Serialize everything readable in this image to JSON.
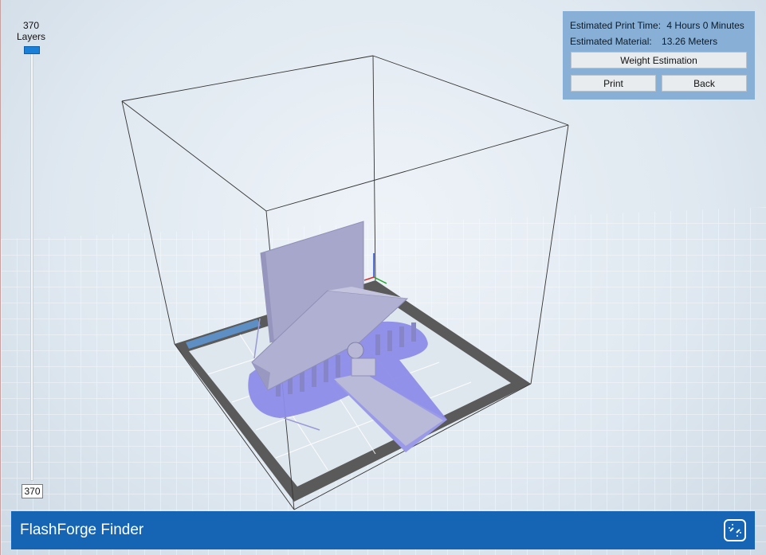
{
  "layer_slider": {
    "count": "370",
    "caption": "Layers",
    "current": "370",
    "position_fraction": 1.0
  },
  "info_panel": {
    "print_time_label": "Estimated Print Time:",
    "print_time_value": "4 Hours 0 Minutes",
    "material_label": "Estimated Material:",
    "material_value": "13.26 Meters",
    "weight_button": "Weight Estimation",
    "print_button": "Print",
    "back_button": "Back"
  },
  "footer": {
    "app_name": "FlashForge Finder",
    "icon": "unlink-icon"
  },
  "colors": {
    "accent": "#1565b4",
    "panel": "#88b0d6",
    "model": "#a9a9cc",
    "support_base": "#8c8ce8",
    "platform_frame": "#555555",
    "slider_handle": "#1a7fd6"
  }
}
